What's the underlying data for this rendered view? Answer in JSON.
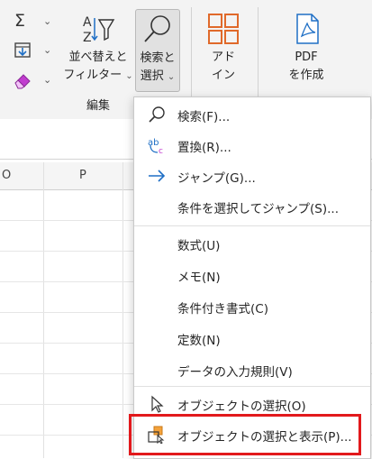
{
  "ribbon": {
    "group_label": "編集",
    "sort_filter": {
      "line1": "並べ替えと",
      "line2": "フィルター"
    },
    "find_select": {
      "line1": "検索と",
      "line2": "選択"
    },
    "addins": {
      "line1": "アド",
      "line2": "イン"
    },
    "pdf": {
      "line1": "PDF",
      "line2": "を作成"
    },
    "autosum_icon": "sigma-icon",
    "fill_icon": "fill-down-icon",
    "clear_icon": "eraser-icon"
  },
  "sheet": {
    "columns": [
      "O",
      "P"
    ]
  },
  "menu": {
    "find": {
      "label": "検索(F)...",
      "icon": "search-icon"
    },
    "replace": {
      "label": "置換(R)...",
      "icon": "replace-icon"
    },
    "goto": {
      "label": "ジャンプ(G)...",
      "icon": "arrow-right-icon"
    },
    "goto_special": {
      "label": "条件を選択してジャンプ(S)..."
    },
    "formulas": {
      "label": "数式(U)"
    },
    "notes": {
      "label": "メモ(N)"
    },
    "conditional_formatting": {
      "label": "条件付き書式(C)"
    },
    "constants": {
      "label": "定数(N)"
    },
    "data_validation": {
      "label": "データの入力規則(V)"
    },
    "select_objects": {
      "label": "オブジェクトの選択(O)",
      "icon": "pointer-icon"
    },
    "selection_pane": {
      "label": "オブジェクトの選択と表示(P)...",
      "icon": "selection-pane-icon"
    }
  },
  "colors": {
    "highlight": "#e2191c",
    "accent": "#1f6fc5",
    "addin_orange": "#e0692a"
  }
}
